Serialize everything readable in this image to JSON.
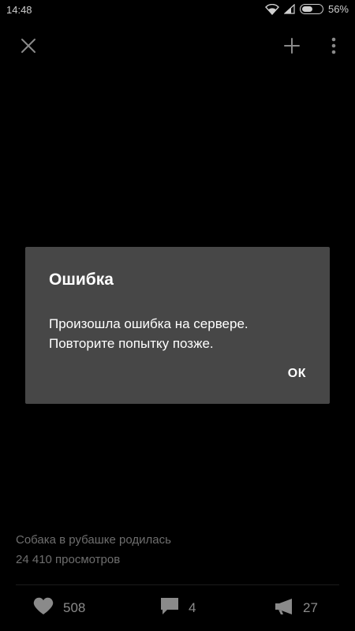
{
  "status_bar": {
    "time": "14:48",
    "battery_percent": "56%",
    "battery_level": 0.56
  },
  "toolbar": {
    "close_icon": "close-icon",
    "add_icon": "plus-icon",
    "more_icon": "more-vertical-icon"
  },
  "dialog": {
    "title": "Ошибка",
    "message": "Произошла ошибка на сервере. Повторите попытку позже.",
    "ok_label": "ОК"
  },
  "post": {
    "title": "Собака в рубашке родилась",
    "views": "24 410 просмотров"
  },
  "actions": {
    "likes": "508",
    "comments": "4",
    "shares": "27"
  },
  "colors": {
    "background": "#000000",
    "dialog": "#474747",
    "muted_text": "#6e6e6e",
    "icon": "#8a8a8a"
  }
}
